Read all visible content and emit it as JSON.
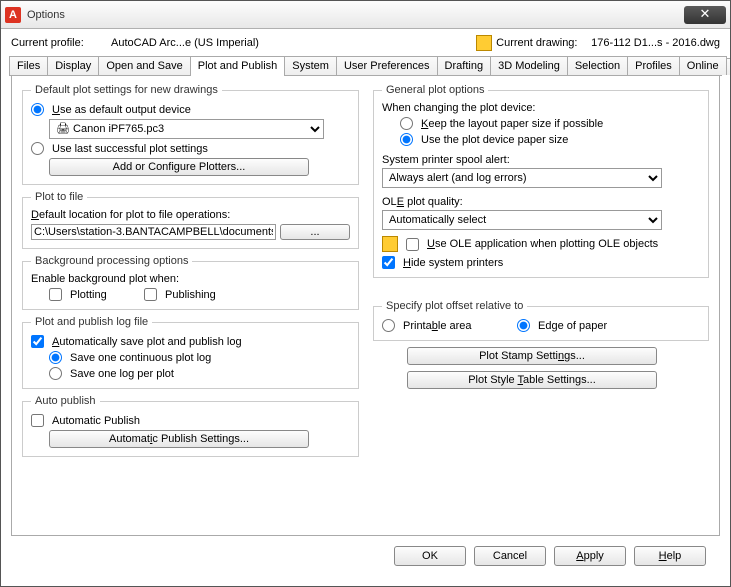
{
  "window": {
    "title": "Options"
  },
  "profile": {
    "label": "Current profile:",
    "value": "AutoCAD Arc...e (US Imperial)",
    "drawing_label": "Current drawing:",
    "drawing_value": "176-112 D1...s - 2016.dwg"
  },
  "tabs": [
    "Files",
    "Display",
    "Open and Save",
    "Plot and Publish",
    "System",
    "User Preferences",
    "Drafting",
    "3D Modeling",
    "Selection",
    "Profiles",
    "Online"
  ],
  "left": {
    "default_plot": {
      "legend": "Default plot settings for new drawings",
      "use_default": "Use as default output device",
      "device": "Canon iPF765.pc3",
      "use_last": "Use last successful plot settings",
      "add_btn": "Add or Configure Plotters..."
    },
    "plot_to_file": {
      "legend": "Plot to file",
      "loc_label": "Default location for plot to file operations:",
      "path": "C:\\Users\\station-3.BANTACAMPBELL\\documents"
    },
    "background": {
      "legend": "Background processing options",
      "enable_label": "Enable background plot when:",
      "plotting": "Plotting",
      "publishing": "Publishing"
    },
    "logfile": {
      "legend": "Plot and publish log file",
      "auto_save": "Automatically save plot and publish log",
      "one_continuous": "Save one continuous plot log",
      "one_per": "Save one log per plot"
    },
    "autopub": {
      "legend": "Auto publish",
      "automatic": "Automatic Publish",
      "settings_btn": "Automatic Publish Settings..."
    }
  },
  "right": {
    "general": {
      "legend": "General plot options",
      "changing": "When changing the plot device:",
      "keep": "Keep the layout paper size if possible",
      "use_device": "Use the plot device paper size",
      "spool_label": "System printer spool alert:",
      "spool_value": "Always alert (and log errors)",
      "ole_label": "OLE plot quality:",
      "ole_value": "Automatically select",
      "use_ole": "Use OLE application when plotting OLE objects",
      "hide_printers": "Hide system printers"
    },
    "offset": {
      "legend": "Specify plot offset relative to",
      "printable": "Printable area",
      "edge": "Edge of paper"
    },
    "plot_stamp_btn": "Plot Stamp Settings...",
    "plot_style_btn": "Plot Style Table Settings..."
  },
  "footer": {
    "ok": "OK",
    "cancel": "Cancel",
    "apply": "Apply",
    "help": "Help"
  }
}
